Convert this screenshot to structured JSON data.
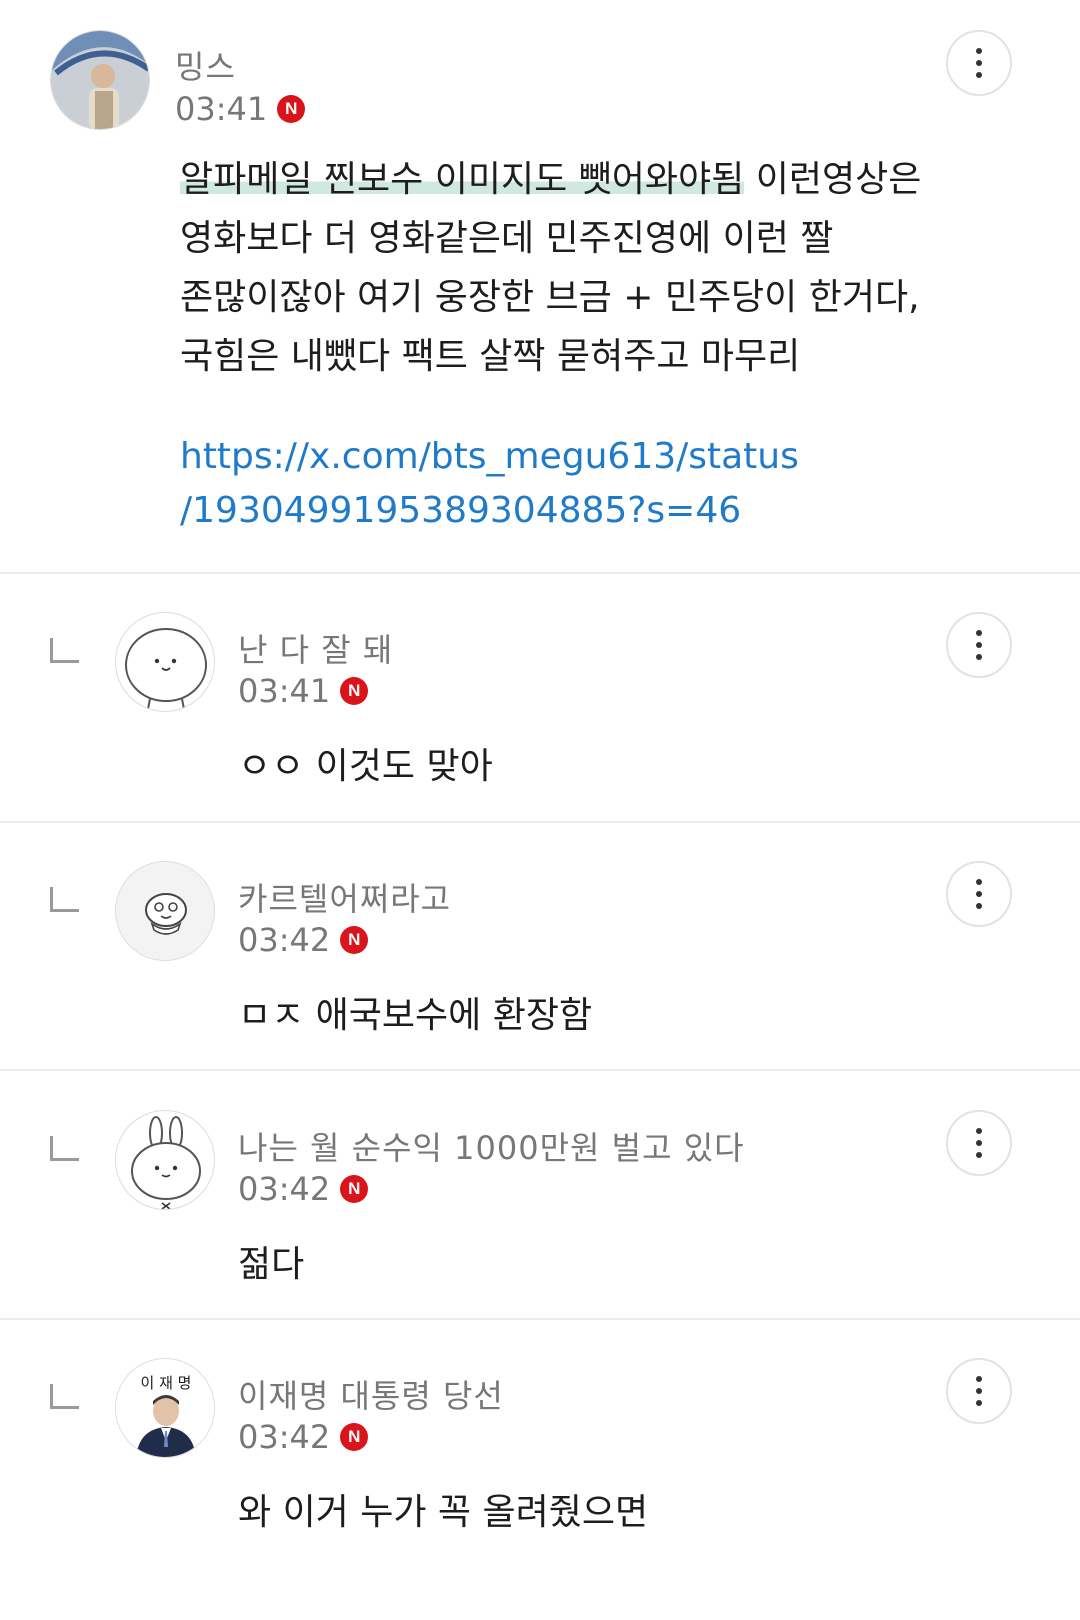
{
  "main_comment": {
    "username": "밍스",
    "time": "03:41",
    "badge": "N",
    "lines": [
      {
        "highlight": "알파메일 찐보수 이미지도 뺏어와야됨",
        "rest": " 이런영상은"
      },
      {
        "highlight": "",
        "rest": "영화보다 더 영화같은데 민주진영에 이런 짤"
      },
      {
        "highlight": "",
        "rest": "존많이잖아 여기 웅장한 브금 + 민주당이 한거다,"
      },
      {
        "highlight": "",
        "rest": "국힘은 내뺐다 팩트 살짝 묻혀주고 마무리"
      }
    ],
    "link_line1": "https://x.com/bts_megu613/status",
    "link_line2": "/1930499195389304885?s=46"
  },
  "replies": [
    {
      "username": "난 다 잘 돼",
      "time": "03:41",
      "badge": "N",
      "text": "ㅇㅇ 이것도 맞아"
    },
    {
      "username": "카르텔어쩌라고",
      "time": "03:42",
      "badge": "N",
      "text": "ㅁㅈ 애국보수에 환장함"
    },
    {
      "username": "나는 월 순수익 1000만원 벌고 있다",
      "time": "03:42",
      "badge": "N",
      "text": "젊다"
    },
    {
      "username": "이재명 대통령 당선",
      "time": "03:42",
      "badge": "N",
      "text": "와 이거 누가 꼭 올려줬으면"
    }
  ],
  "avatar_text": {
    "last_reply_name_label": "이 재 명"
  },
  "colors": {
    "badge": "#d9141b",
    "link": "#1f7bc9",
    "highlight": "#cfe8e2"
  }
}
